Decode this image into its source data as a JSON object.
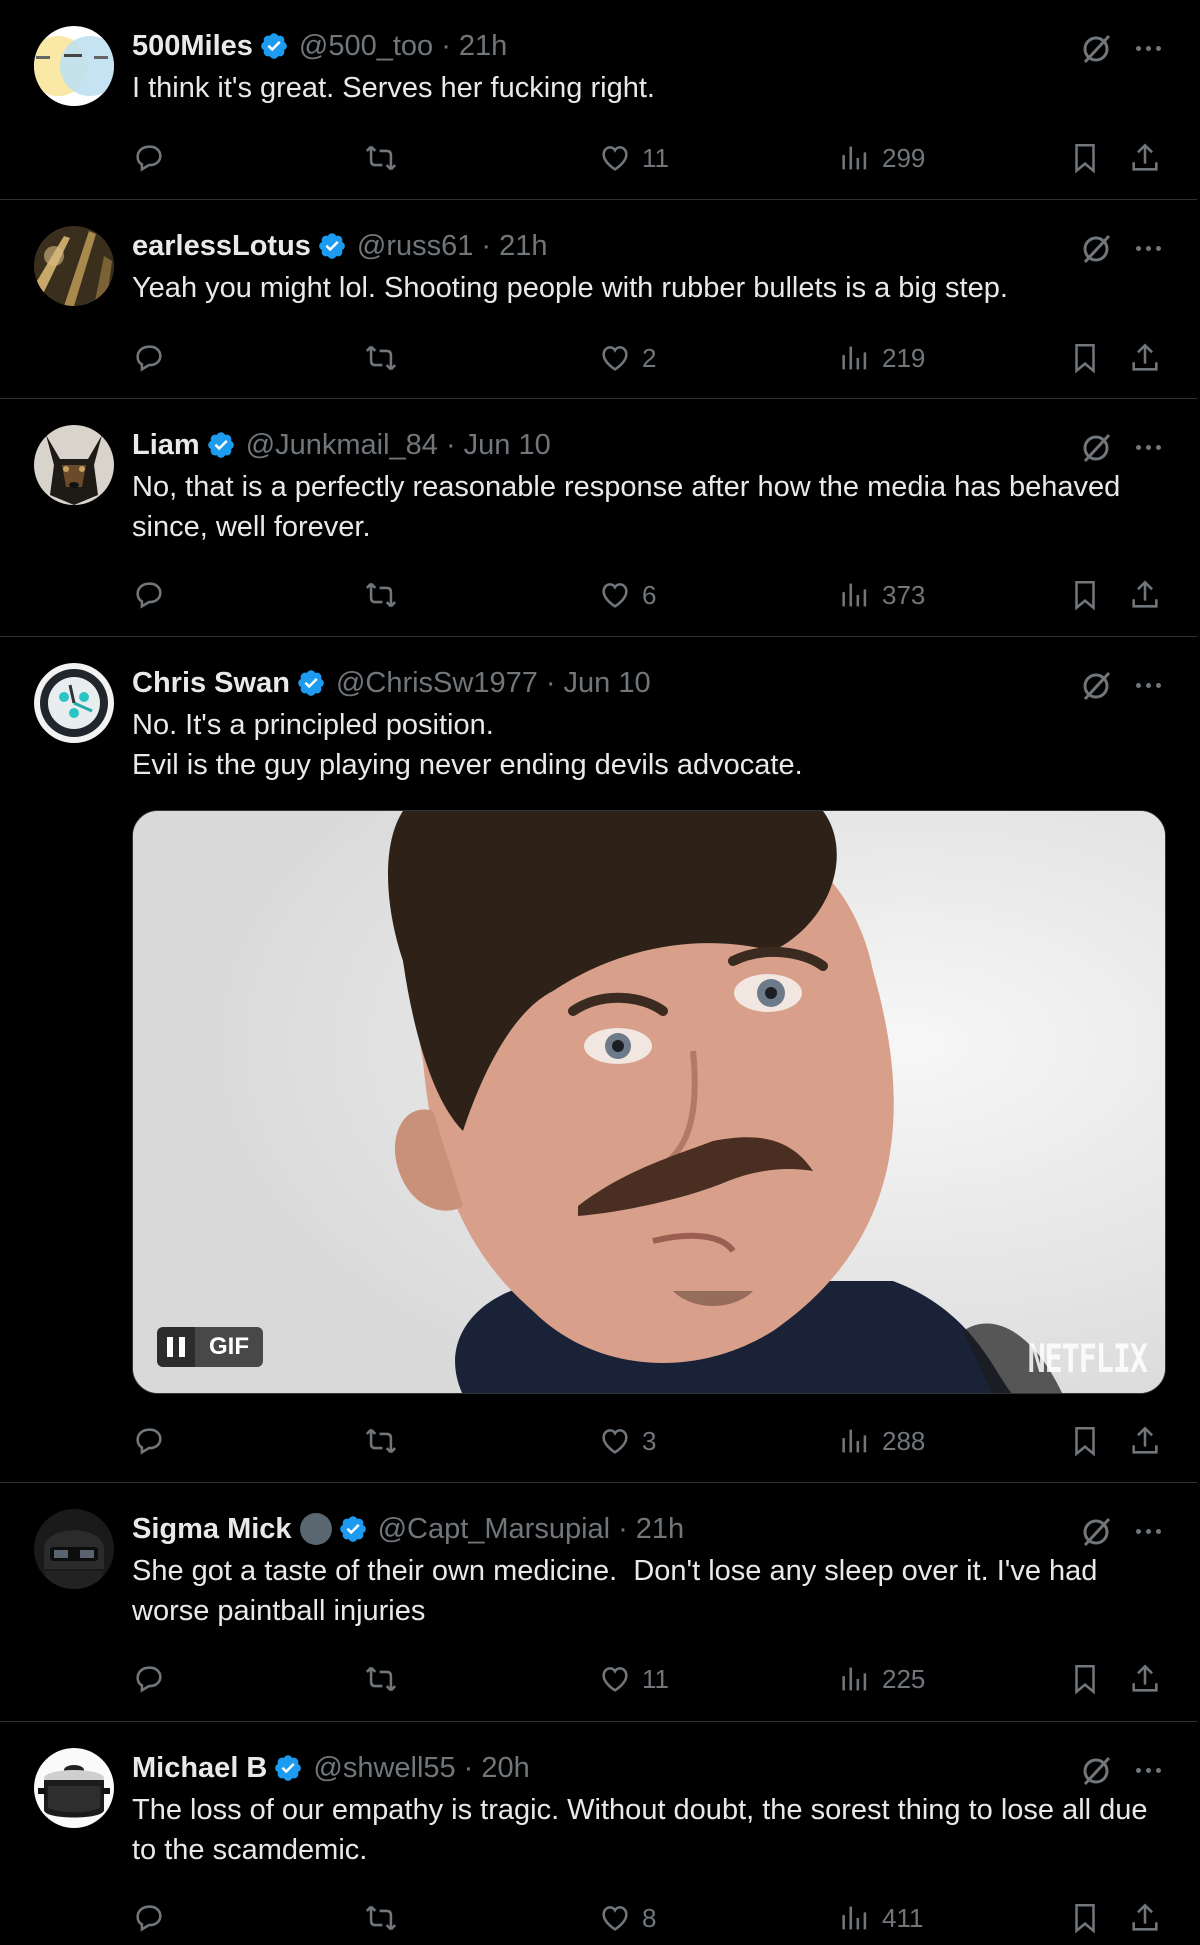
{
  "posts": [
    {
      "name": "500Miles",
      "handle": "@500_too",
      "time": "21h",
      "text": "I think it's great. Serves her fucking right.",
      "replies": "",
      "reposts": "",
      "likes": "11",
      "views": "299",
      "avatar": "500miles-avatar"
    },
    {
      "name": "earlessLotus",
      "handle": "@russ61",
      "time": "21h",
      "text": "Yeah you might lol. Shooting people with rubber bullets is a big step.",
      "likes": "2",
      "views": "219",
      "avatar": "earlesslotus-avatar"
    },
    {
      "name": "Liam",
      "handle": "@Junkmail_84",
      "time": "Jun 10",
      "text": "No, that is a perfectly reasonable response after how the media has behaved since, well forever.",
      "likes": "6",
      "views": "373",
      "avatar": "dog-avatar"
    },
    {
      "name": "Chris Swan",
      "handle": "@ChrisSw1977",
      "time": "Jun 10",
      "text_lines": [
        "No. It's a principled position.",
        "Evil is the guy playing never ending devils advocate."
      ],
      "likes": "3",
      "views": "288",
      "media": {
        "type": "gif",
        "badge": "GIF",
        "watermark": "NETFLIX"
      },
      "avatar": "watch-avatar"
    },
    {
      "name": "Sigma Mick",
      "handle": "@Capt_Marsupial",
      "time": "21h",
      "text": "She got a taste of their own medicine.  Don't lose any sleep over it. I've had worse paintball injuries",
      "likes": "11",
      "views": "225",
      "avatar": "helmet-avatar"
    },
    {
      "name": "Michael B",
      "handle": "@shwell55",
      "time": "20h",
      "text": "The loss of our empathy is tragic. Without doubt, the sorest thing to lose all due to the scamdemic.",
      "likes": "8",
      "views": "411",
      "avatar": "pot-avatar"
    }
  ],
  "separator": "·",
  "colors": {
    "background": "#000000",
    "text": "#e7e9ea",
    "muted": "#71767b",
    "verified": "#1d9bf0",
    "divider": "#2f3336"
  }
}
